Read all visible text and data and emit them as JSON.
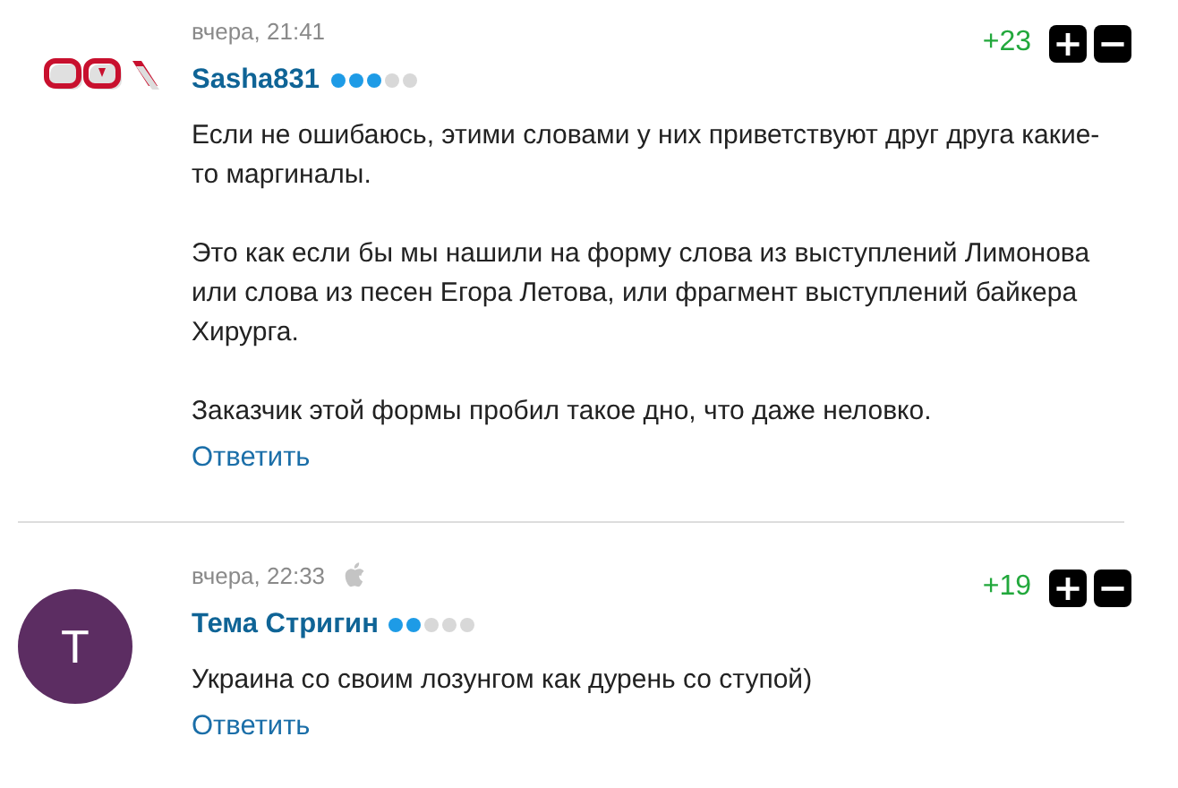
{
  "comments": [
    {
      "date": "вчера, 21:41",
      "platform_icon": false,
      "author": "Sasha831",
      "stars": 3,
      "score": "+23",
      "plus": "+",
      "minus": "−",
      "paragraphs": [
        "Если не ошибаюсь, этими словами у них приветствуют друг друга какие-то маргиналы.",
        "Это как если бы мы нашили на форму слова из выступлений Лимонова или слова из песен Егора Летова, или фрагмент выступлений байкера Хирурга.",
        "Заказчик этой формы пробил такое дно, что даже неловко."
      ],
      "reply": "Ответить"
    },
    {
      "avatar": {
        "kind": "letter",
        "letter": "Т",
        "color": "#5c2d62"
      },
      "date": "вчера, 22:33",
      "platform_icon": true,
      "author": "Тема Стригин",
      "stars": 2,
      "score": "+19",
      "plus": "+",
      "minus": "−",
      "paragraphs": [
        "Украина со своим лозунгом как дурень со ступой)"
      ],
      "reply": "Ответить"
    }
  ]
}
